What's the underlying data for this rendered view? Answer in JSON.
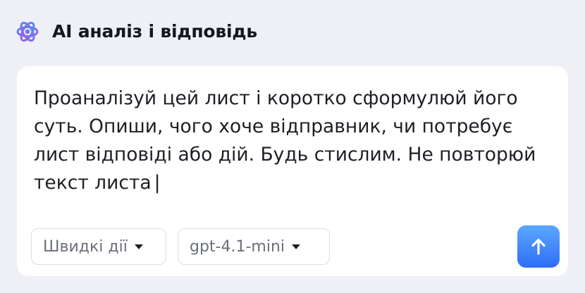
{
  "header": {
    "title": "AI аналіз і відповідь",
    "icon": "ai-sparkle-icon",
    "icon_colors": [
      "#5b8def",
      "#9b5cf6"
    ]
  },
  "composer": {
    "prompt_text": "Проаналізуй цей лист і коротко сформулюй його суть. Опиши, чого хоче відправник, чи потребує лист відповіді або дій. Будь стислим. Не повторюй текст листа",
    "caret": "|",
    "quick_actions": {
      "label": "Швидкі дії",
      "icon": "chevron-down-icon"
    },
    "model": {
      "label": "gpt-4.1-mini",
      "icon": "chevron-down-icon"
    },
    "send_button": {
      "icon": "arrow-up-icon",
      "color": "#2f6df6"
    }
  },
  "colors": {
    "background": "#eef0f5",
    "card": "#ffffff",
    "accent": "#2f6df6"
  }
}
